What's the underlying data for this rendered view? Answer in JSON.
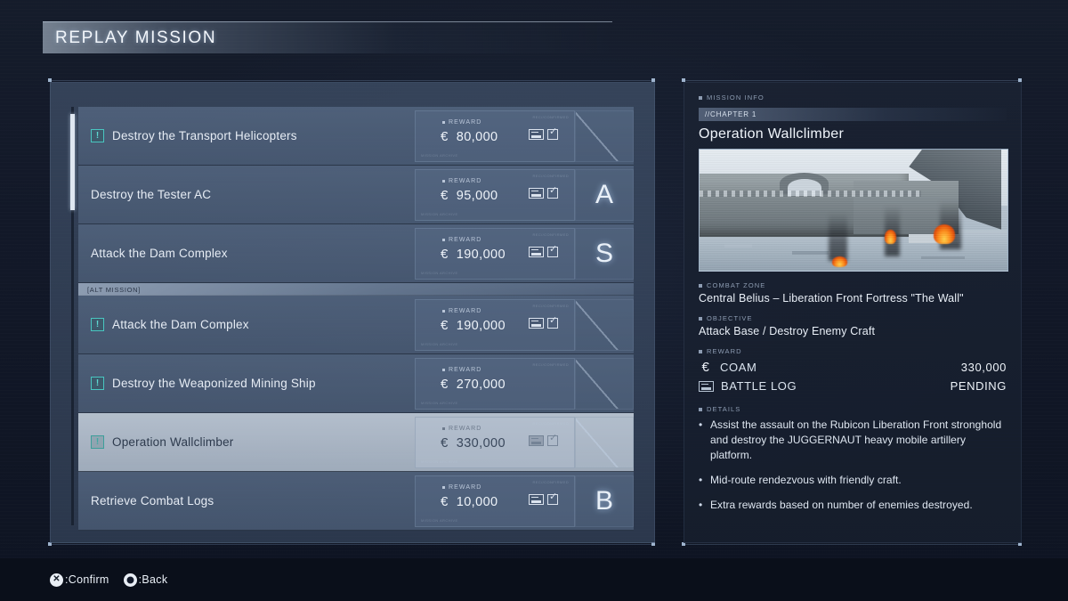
{
  "header": {
    "title": "REPLAY MISSION"
  },
  "missions": [
    {
      "name": "Destroy the Transport Helicopters",
      "alert": true,
      "reward_label": "REWARD",
      "currency": "€",
      "reward": "80,000",
      "battle_log": true,
      "rank": "",
      "alt": false,
      "selected": false,
      "micro": "MISSION ARCHIVE",
      "micro_tr": "REC//CONFIRMED"
    },
    {
      "name": "Destroy the Tester AC",
      "alert": false,
      "reward_label": "REWARD",
      "currency": "€",
      "reward": "95,000",
      "battle_log": true,
      "rank": "A",
      "alt": false,
      "selected": false,
      "micro": "MISSION ARCHIVE",
      "micro_tr": "REC//CONFIRMED"
    },
    {
      "name": "Attack the Dam Complex",
      "alert": false,
      "reward_label": "REWARD",
      "currency": "€",
      "reward": "190,000",
      "battle_log": true,
      "rank": "S",
      "alt": false,
      "selected": false,
      "micro": "MISSION ARCHIVE",
      "micro_tr": "REC//CONFIRMED"
    },
    {
      "name": "Attack the Dam Complex",
      "alert": true,
      "reward_label": "REWARD",
      "currency": "€",
      "reward": "190,000",
      "battle_log": true,
      "rank": "",
      "alt": true,
      "alt_label": "[ALT MISSION]",
      "selected": false,
      "micro": "MISSION ARCHIVE",
      "micro_tr": "REC//CONFIRMED"
    },
    {
      "name": "Destroy the Weaponized Mining Ship",
      "alert": true,
      "reward_label": "REWARD",
      "currency": "€",
      "reward": "270,000",
      "battle_log": false,
      "rank": "",
      "alt": false,
      "selected": false,
      "micro": "MISSION ARCHIVE",
      "micro_tr": "REC//CONFIRMED"
    },
    {
      "name": "Operation Wallclimber",
      "alert": true,
      "reward_label": "REWARD",
      "currency": "€",
      "reward": "330,000",
      "battle_log": true,
      "rank": "",
      "alt": false,
      "selected": true,
      "micro": "MISSION ARCHIVE",
      "micro_tr": "REC//CONFIRMED"
    },
    {
      "name": "Retrieve Combat Logs",
      "alert": false,
      "reward_label": "REWARD",
      "currency": "€",
      "reward": "10,000",
      "battle_log": true,
      "rank": "B",
      "alt": false,
      "selected": false,
      "micro": "MISSION ARCHIVE",
      "micro_tr": "REC//CONFIRMED"
    }
  ],
  "info": {
    "panel_label": "MISSION INFO",
    "chapter": "//CHAPTER 1",
    "title": "Operation Wallclimber",
    "combat_zone_label": "COMBAT ZONE",
    "combat_zone": "Central Belius – Liberation Front Fortress \"The Wall\"",
    "objective_label": "OBJECTIVE",
    "objective": "Attack Base / Destroy Enemy Craft",
    "reward_label": "REWARD",
    "reward_rows": [
      {
        "icon": "euro-icon",
        "name": "COAM",
        "value": "330,000"
      },
      {
        "icon": "battle-log-icon",
        "name": "BATTLE LOG",
        "value": "PENDING"
      }
    ],
    "details_label": "DETAILS",
    "details": [
      "Assist the assault on the Rubicon Liberation Front stronghold and destroy the JUGGERNAUT heavy mobile artillery platform.",
      "Mid-route rendezvous with friendly craft.",
      "Extra rewards based on number of enemies destroyed."
    ]
  },
  "footer": {
    "prompts": [
      {
        "glyph": "✕",
        "type": "cross",
        "label": ":Confirm"
      },
      {
        "glyph": "",
        "type": "circle",
        "label": ":Back"
      }
    ]
  },
  "colors": {
    "accent_teal": "#49c6c0",
    "selected_row": "#bec9d6",
    "panel_blue": "#566b88"
  }
}
